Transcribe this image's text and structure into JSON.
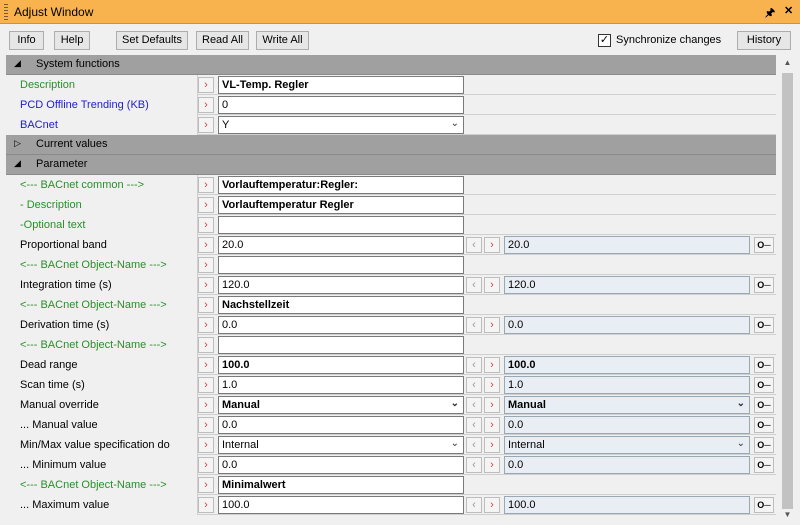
{
  "window": {
    "title": "Adjust Window",
    "pin_icon": "pin-icon",
    "close_icon": "close-icon",
    "pin_glyph": "\u0001",
    "close_glyph": "x"
  },
  "toolbar": {
    "info": "Info",
    "help": "Help",
    "set_defaults": "Set Defaults",
    "read_all": "Read All",
    "write_all": "Write All",
    "sync_label": "Synchronize changes",
    "sync_checked": true,
    "history": "History"
  },
  "sections": {
    "system_functions": "System functions",
    "current_values": "Current values",
    "parameter": "Parameter"
  },
  "rows": {
    "description": {
      "label": "Description",
      "value": "VL-Temp. Regler"
    },
    "pcd_trending": {
      "label": "PCD Offline Trending (KB)",
      "value": "0"
    },
    "bacnet": {
      "label": "BACnet",
      "value": "Y"
    },
    "bacnet_common": {
      "label": "<--- BACnet common --->",
      "value": "Vorlauftemperatur:Regler:"
    },
    "p_description": {
      "label": "- Description",
      "value": "Vorlauftemperatur Regler"
    },
    "optional_text": {
      "label": "-Optional text",
      "value": ""
    },
    "proportional_band": {
      "label": "Proportional band",
      "value": "20.0",
      "value2": "20.0"
    },
    "objname1": {
      "label": "<--- BACnet Object-Name --->",
      "value": ""
    },
    "integration_time": {
      "label": "Integration time (s)",
      "value": "120.0",
      "value2": "120.0"
    },
    "objname2": {
      "label": "<--- BACnet Object-Name --->",
      "value": "Nachstellzeit"
    },
    "derivation_time": {
      "label": "Derivation time (s)",
      "value": "0.0",
      "value2": "0.0"
    },
    "objname3": {
      "label": "<--- BACnet Object-Name --->",
      "value": ""
    },
    "dead_range": {
      "label": "Dead range",
      "value": "100.0",
      "value2": "100.0"
    },
    "scan_time": {
      "label": "Scan time (s)",
      "value": "1.0",
      "value2": "1.0"
    },
    "manual_override": {
      "label": "Manual override",
      "value": "Manual",
      "value2": "Manual"
    },
    "manual_value": {
      "label": "... Manual value",
      "value": "0.0",
      "value2": "0.0"
    },
    "minmax_spec": {
      "label": "Min/Max value specification do",
      "value": "Internal",
      "value2": "Internal"
    },
    "minimum_value": {
      "label": "... Minimum value",
      "value": "0.0",
      "value2": "0.0"
    },
    "objname4": {
      "label": "<--- BACnet Object-Name --->",
      "value": "Minimalwert"
    },
    "maximum_value": {
      "label": "... Maximum value",
      "value": "100.0",
      "value2": "100.0"
    }
  },
  "glyphs": {
    "expanded": "◢",
    "collapsed": "▷",
    "arrow_right": "›",
    "arrow_left": "‹",
    "chevron": "⌄",
    "key": "O─",
    "scroll_up": "▲",
    "scroll_down": "▼"
  },
  "colors": {
    "title_bar": "#f8b34f",
    "section_bg": "#a0a0a0",
    "label_green": "#2a8f2a",
    "label_blue": "#2020d0",
    "arrow_red": "#cc4444"
  }
}
